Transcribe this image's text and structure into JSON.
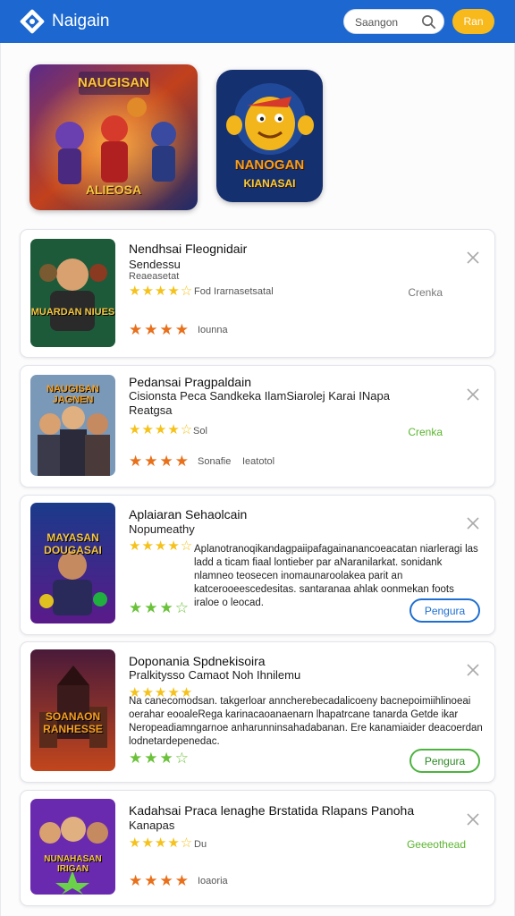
{
  "header": {
    "brand": "Naigain",
    "search_placeholder": "Saangon",
    "button_label": "Ran",
    "brand_color": "#1c68d0",
    "accent_color": "#f7b91b"
  },
  "featured": [
    {
      "art_text_top": "NAUGISAN",
      "art_text_bottom": "ALIEOSA"
    },
    {
      "art_text_top": "NANOGAN",
      "art_text_bottom": "KIANASAI"
    }
  ],
  "cards": [
    {
      "title": "Nendhsai Fleognidair",
      "subtitle": "Sendessu",
      "subtitle_small": "Reaeasetat",
      "rating_small": "★★★★☆",
      "meta_1": "Fod  Irarnasetsatal",
      "status": "Crenka",
      "rating_large": "★★★★",
      "meta_2": "Iounna",
      "thumb_text": "MUARDAN NIUES"
    },
    {
      "title": "Pedansai Pragpaldain",
      "subtitle": "Cisionsta Peca Sandkeka IlamSiarolej Karai INapa",
      "subtitle_2": "Reatgsa",
      "rating_small": "★★★★☆",
      "meta_1": "Sol",
      "status": "Crenka",
      "rating_large": "★★★★",
      "meta_2": "Sonafie",
      "meta_3": "Ieatotol",
      "thumb_text": "NAUGISAN JAGNEN"
    },
    {
      "title": "Aplaiaran Sehaolcain",
      "subtitle": "Nopumeathy",
      "rating_small": "★★★★☆",
      "description": "Aplanotranoqikandagpaiipafagainanancoeacatan niarleragi las ladd a ticam fiaal lontieber par aNaranilarkat. sonidank nlamneo teosecen inomaunaroolakea parit an katcerooeescedesitas. santaranaa ahlak oonmekan foots iraloe o leocad.",
      "rating_large": "★★★☆",
      "button_label": "Pengura",
      "thumb_text": "MAYASAN DOUGASAI"
    },
    {
      "title": "Doponania Spdnekisoira",
      "subtitle": "Pralkitysso Camaot Noh Ihnilemu",
      "rating_small": "★★★★★",
      "description": "Na canecomodsan. takgerloar anncherebecadalicoeny bacnepoimiihlinoeai oerahar eooaleRega karinacaoanaenarn lhapatrcane tanarda Getde ikar Neropeadiamngarnoe anharunninsahadabanan. Ere kanamiaider deacoerdan lodnetardepenedac.",
      "rating_large": "★★★☆",
      "button_label": "Pengura",
      "thumb_text": "SOANAON RANHESSE"
    },
    {
      "title": "Kadahsai Praca lenaghe Brstatida Rlapans Panoha",
      "subtitle": "Kanapas",
      "rating_small": "★★★★☆",
      "meta_1": "Du",
      "status": "Geeeothead",
      "rating_large": "★★★★",
      "meta_2": "Ioaoria",
      "thumb_text": "NUNAHASAN IRIGAN"
    }
  ],
  "colors": {
    "star_yellow": "#f5c21b",
    "star_orange": "#e8701b",
    "star_green": "#6bc23a",
    "status_gray": "#777777",
    "status_green": "#5cb531",
    "pill_blue": "#1f6fd1",
    "pill_green": "#4db340"
  }
}
